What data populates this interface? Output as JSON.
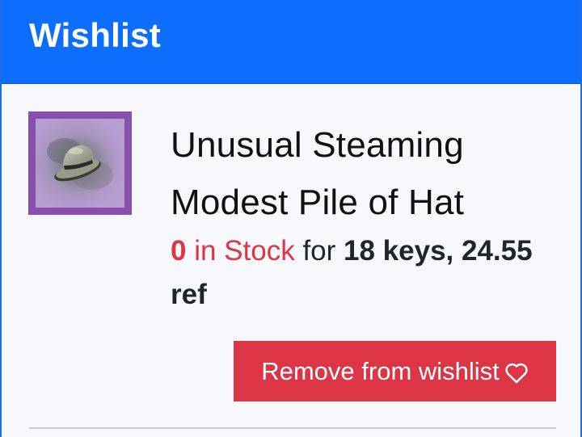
{
  "header": {
    "title": "Wishlist"
  },
  "item": {
    "name": "Unusual Steaming Modest Pile of Hat",
    "stock_count": "0",
    "stock_label": "in Stock",
    "for_label": "for",
    "price": "18 keys, 24.55 ref",
    "thumbnail_icon": "hat-icon"
  },
  "actions": {
    "remove_label": "Remove from wishlist",
    "remove_icon": "heart-outline-icon"
  },
  "colors": {
    "header_bg": "#0d6efd",
    "danger": "#dc3545",
    "quality_border": "#8650ac",
    "page_bg": "#f6f8fb"
  }
}
